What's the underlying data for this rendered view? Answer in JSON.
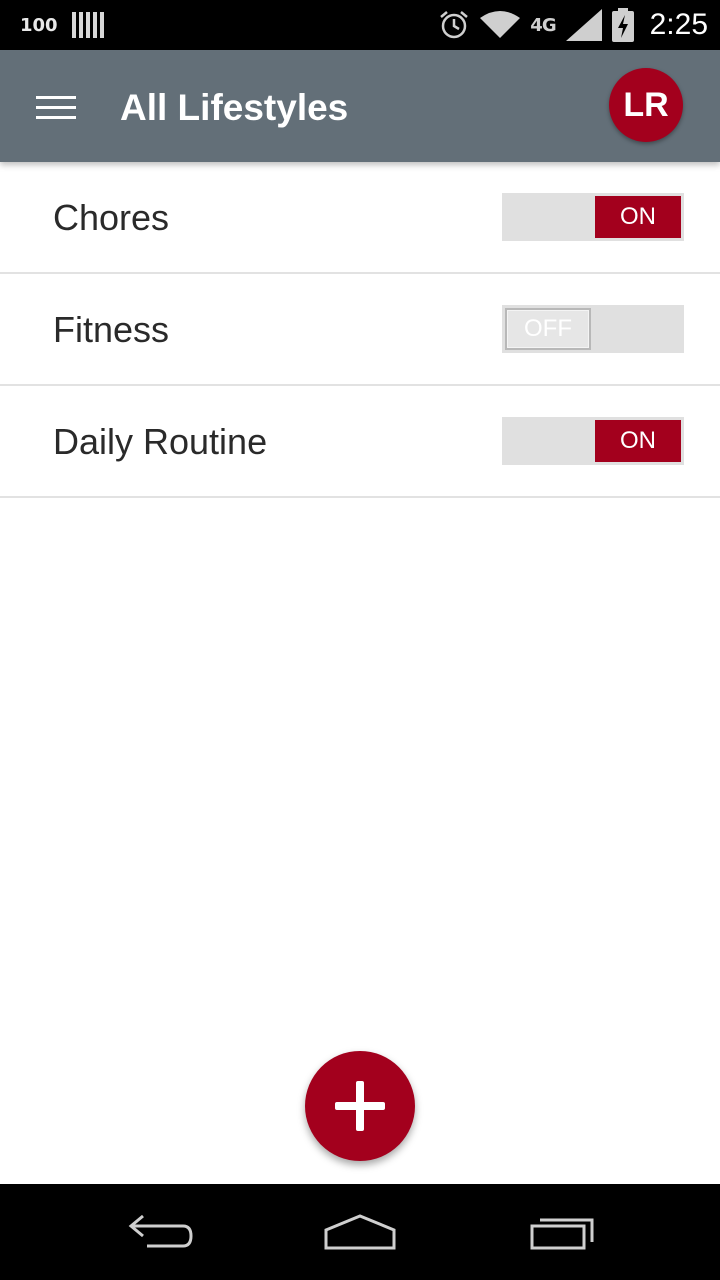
{
  "status_bar": {
    "battery_level": "100",
    "network": "4G",
    "time": "2:25",
    "icons": [
      "battery-bars-icon",
      "alarm-icon",
      "wifi-icon",
      "lte-icon",
      "signal-icon",
      "battery-charging-icon"
    ]
  },
  "app_bar": {
    "menu_icon": "hamburger-menu-icon",
    "title": "All Lifestyles",
    "avatar_initials": "LR"
  },
  "lifestyles": [
    {
      "label": "Chores",
      "toggle": "ON",
      "enabled": true
    },
    {
      "label": "Fitness",
      "toggle": "OFF",
      "enabled": false
    },
    {
      "label": "Daily Routine",
      "toggle": "ON",
      "enabled": true
    }
  ],
  "fab": {
    "icon": "add-icon"
  },
  "nav_bar": {
    "icons": [
      "back-icon",
      "home-icon",
      "recents-icon"
    ]
  },
  "colors": {
    "accent": "#a3001d",
    "app_bar": "#636f78",
    "toggle_track": "#e0e0e0",
    "divider": "#e2e2e2"
  }
}
